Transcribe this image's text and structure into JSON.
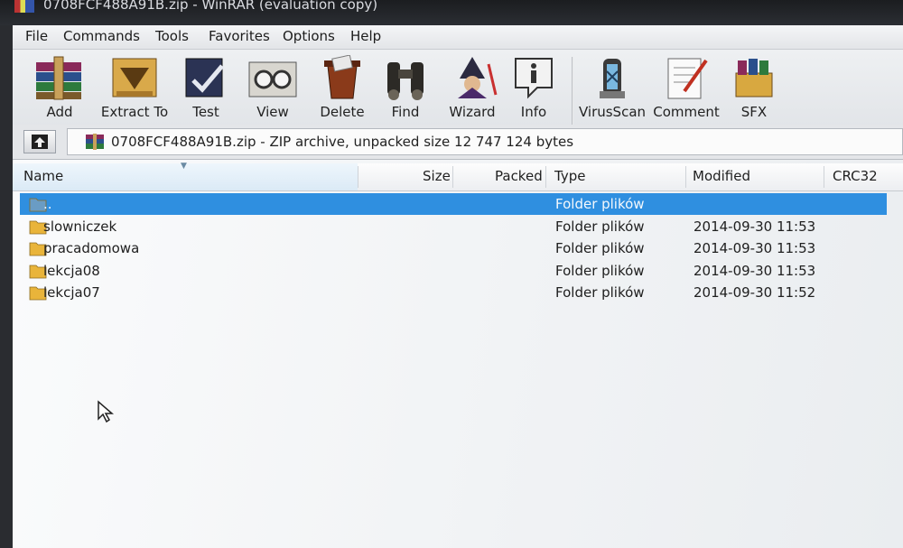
{
  "window_title": "0708FCF488A91B.zip - WinRAR (evaluation copy)",
  "menu": [
    "File",
    "Commands",
    "Tools",
    "Favorites",
    "Options",
    "Help"
  ],
  "toolbar": [
    {
      "label": "Add",
      "icon": "archive-books-icon"
    },
    {
      "label": "Extract To",
      "icon": "extract-folder-icon"
    },
    {
      "label": "Test",
      "icon": "test-check-icon"
    },
    {
      "label": "View",
      "icon": "view-glasses-icon"
    },
    {
      "label": "Delete",
      "icon": "delete-icon"
    },
    {
      "label": "Find",
      "icon": "binoculars-icon"
    },
    {
      "label": "Wizard",
      "icon": "wizard-icon"
    },
    {
      "label": "Info",
      "icon": "info-icon"
    },
    {
      "label": "VirusScan",
      "icon": "virus-scan-icon"
    },
    {
      "label": "Comment",
      "icon": "comment-icon"
    },
    {
      "label": "SFX",
      "icon": "sfx-icon"
    }
  ],
  "address": {
    "path": "0708FCF488A91B.zip - ZIP archive, unpacked size 12 747 124 bytes"
  },
  "columns": {
    "name": "Name",
    "size": "Size",
    "packed": "Packed",
    "type": "Type",
    "modified": "Modified",
    "crc": "CRC32"
  },
  "rows": [
    {
      "name": "..",
      "type": "Folder plików",
      "modified": "",
      "selected": true
    },
    {
      "name": "slowniczek",
      "type": "Folder plików",
      "modified": "2014-09-30 11:53"
    },
    {
      "name": "pracadomowa",
      "type": "Folder plików",
      "modified": "2014-09-30 11:53"
    },
    {
      "name": "lekcja08",
      "type": "Folder plików",
      "modified": "2014-09-30 11:53"
    },
    {
      "name": "lekcja07",
      "type": "Folder plików",
      "modified": "2014-09-30 11:52"
    }
  ],
  "colors": {
    "selection": "#2f8fe0",
    "folder": "#e9b43a"
  }
}
